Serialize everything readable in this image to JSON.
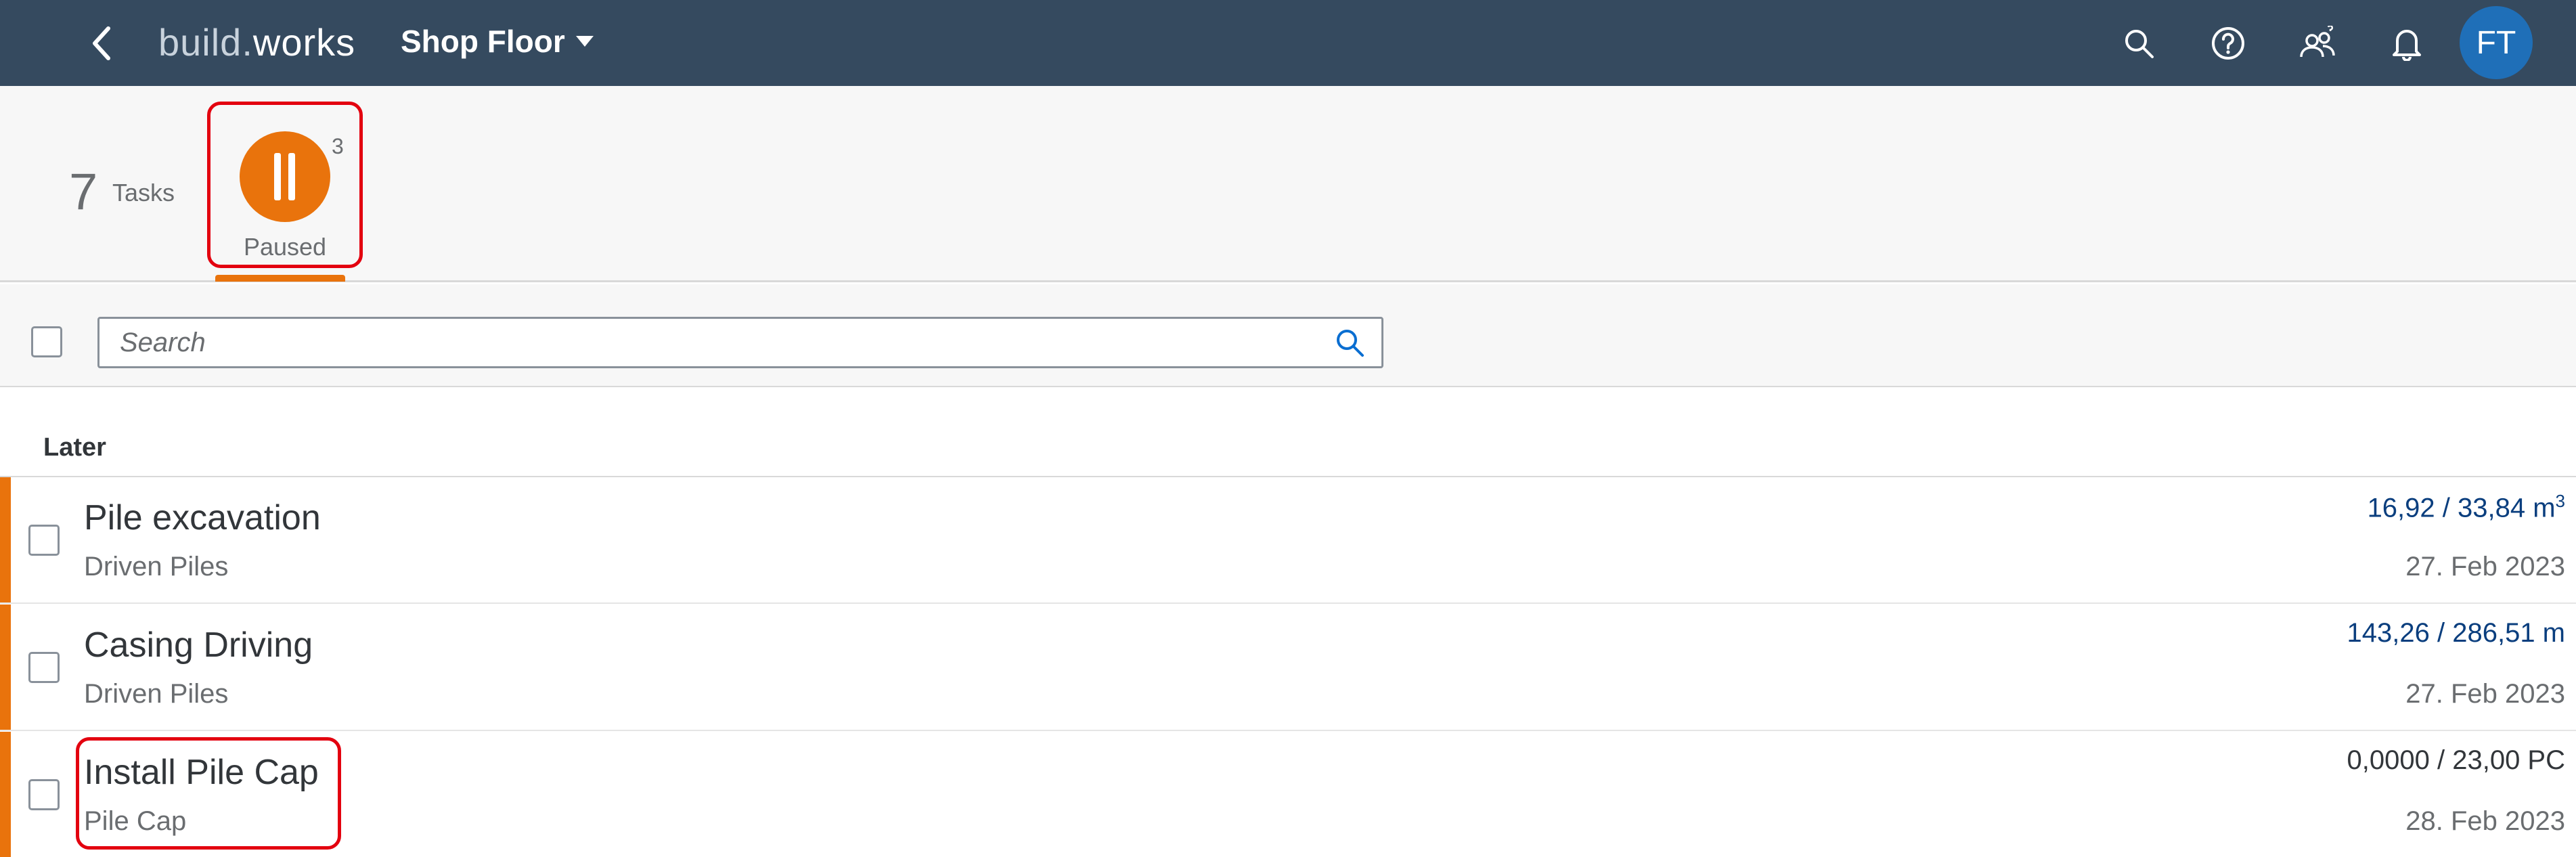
{
  "shell": {
    "logo_part1": "build",
    "logo_dot": ".",
    "logo_part2": "works",
    "app_title": "Shop Floor",
    "avatar_initials": "FT"
  },
  "header": {
    "total_count": "7",
    "total_label": "Tasks",
    "filters": [
      {
        "label": "Paused",
        "badge": "3",
        "icon": "pause-icon",
        "color": "#e9730c",
        "selected": true
      }
    ]
  },
  "search": {
    "placeholder": "Search",
    "value": ""
  },
  "list": {
    "group_title": "Later",
    "items": [
      {
        "title": "Pile excavation",
        "subtitle": "Driven Piles",
        "quantity": "16,92 / 33,84 m",
        "unit_superscript": "3",
        "date": "27. Feb 2023",
        "status_color": "#e9730c"
      },
      {
        "title": "Casing Driving",
        "subtitle": "Driven Piles",
        "quantity": "143,26 / 286,51 m",
        "date": "27. Feb 2023",
        "status_color": "#e9730c"
      },
      {
        "title": "Install Pile Cap",
        "subtitle": "Pile Cap",
        "quantity": "0,0000 / 23,00 PC",
        "date": "28. Feb 2023",
        "status_color": "#e9730c"
      }
    ]
  },
  "colors": {
    "shell_bg": "#354a5f",
    "accent_orange": "#e9730c",
    "highlight_red": "#e3000f",
    "link_blue": "#0a3e7e"
  }
}
